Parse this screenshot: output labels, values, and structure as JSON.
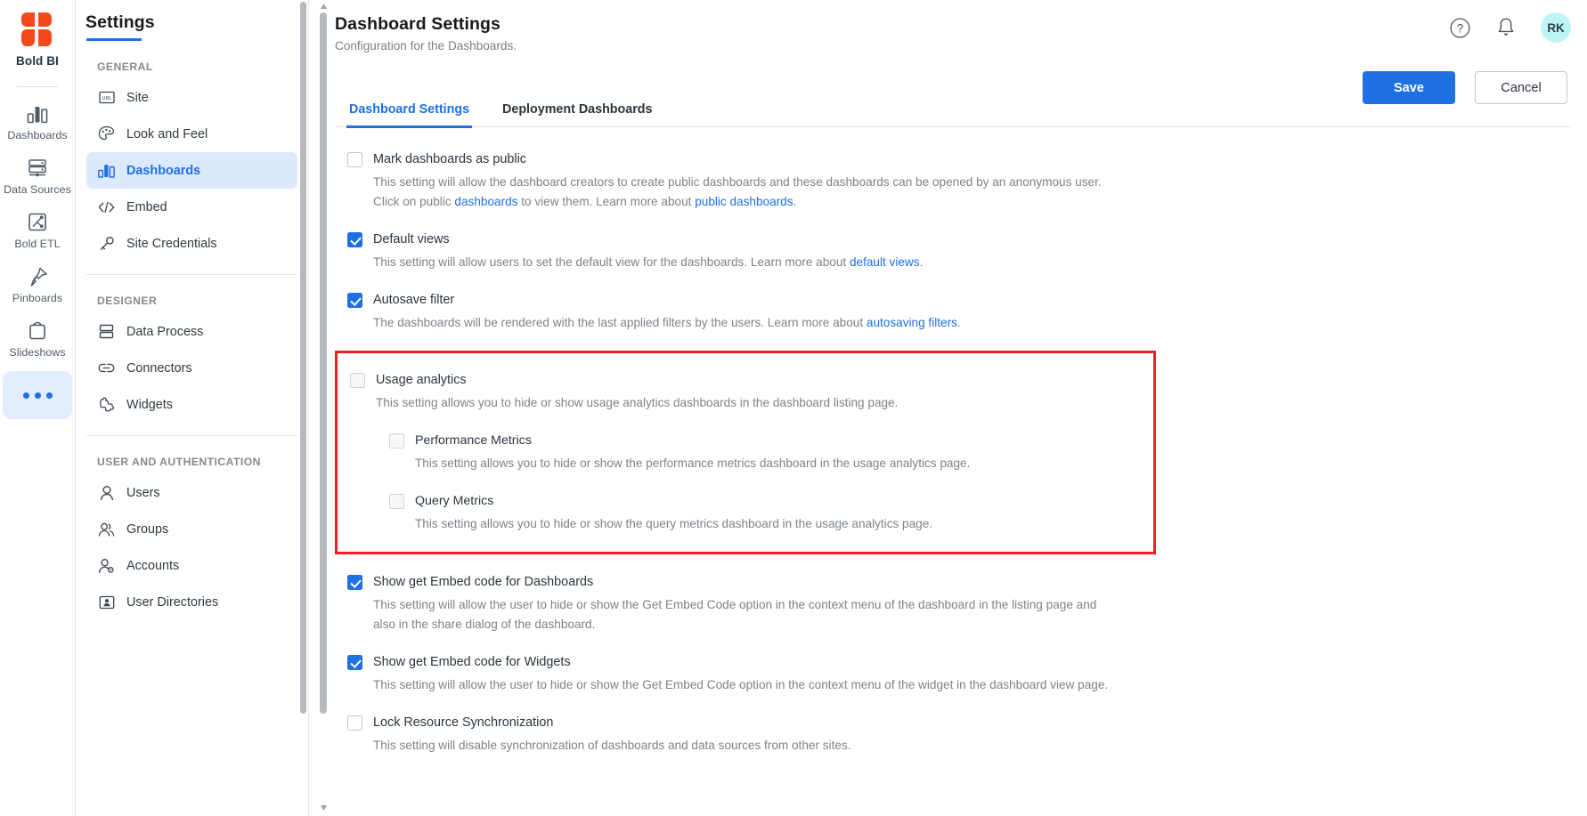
{
  "brand": {
    "name": "Bold BI",
    "logo_icon": "bold-bi-logo"
  },
  "rail": {
    "items": [
      {
        "label": "Dashboards",
        "icon": "bar-chart-icon"
      },
      {
        "label": "Data Sources",
        "icon": "database-icon"
      },
      {
        "label": "Bold ETL",
        "icon": "etl-flow-icon"
      },
      {
        "label": "Pinboards",
        "icon": "pin-icon"
      },
      {
        "label": "Slideshows",
        "icon": "tv-icon"
      }
    ],
    "more_label": "more-options",
    "more_icon": "ellipsis-icon"
  },
  "settings_nav": {
    "title": "Settings",
    "groups": [
      {
        "label": "GENERAL",
        "items": [
          {
            "label": "Site",
            "icon": "url-box-icon",
            "active": false
          },
          {
            "label": "Look and Feel",
            "icon": "palette-icon",
            "active": false
          },
          {
            "label": "Dashboards",
            "icon": "bar-chart-icon",
            "active": true
          },
          {
            "label": "Embed",
            "icon": "code-brackets-icon",
            "active": false
          },
          {
            "label": "Site Credentials",
            "icon": "key-icon",
            "active": false
          }
        ]
      },
      {
        "label": "DESIGNER",
        "items": [
          {
            "label": "Data Process",
            "icon": "stacked-rows-icon",
            "active": false
          },
          {
            "label": "Connectors",
            "icon": "link-icon",
            "active": false
          },
          {
            "label": "Widgets",
            "icon": "puzzle-icon",
            "active": false
          }
        ]
      },
      {
        "label": "USER AND AUTHENTICATION",
        "items": [
          {
            "label": "Users",
            "icon": "user-icon",
            "active": false
          },
          {
            "label": "Groups",
            "icon": "users-group-icon",
            "active": false
          },
          {
            "label": "Accounts",
            "icon": "user-gear-icon",
            "active": false
          },
          {
            "label": "User Directories",
            "icon": "id-card-icon",
            "active": false
          }
        ]
      }
    ]
  },
  "header": {
    "title": "Dashboard Settings",
    "subtitle": "Configuration for the Dashboards.",
    "help_icon": "question-circle-icon",
    "notification_icon": "bell-icon",
    "avatar_initials": "RK"
  },
  "actions": {
    "save_label": "Save",
    "cancel_label": "Cancel"
  },
  "tabs": [
    {
      "label": "Dashboard Settings",
      "active": true
    },
    {
      "label": "Deployment Dashboards",
      "active": false
    }
  ],
  "settings": {
    "mark_public": {
      "label": "Mark dashboards as public",
      "checked": false,
      "desc_part1": "This setting will allow the dashboard creators to create public dashboards and these dashboards can be opened by an anonymous user. Click on public ",
      "link1": "dashboards",
      "desc_part2": " to view them. Learn more about ",
      "link2": "public dashboards",
      "desc_part3": "."
    },
    "default_views": {
      "label": "Default views",
      "checked": true,
      "desc_part1": "This setting will allow users to set the default view for the dashboards. Learn more about ",
      "link1": "default views",
      "desc_part2": "."
    },
    "autosave_filter": {
      "label": "Autosave filter",
      "checked": true,
      "desc_part1": "The dashboards will be rendered with the last applied filters by the users. Learn more about ",
      "link1": "autosaving filters",
      "desc_part2": "."
    },
    "usage_analytics": {
      "label": "Usage analytics",
      "checked": false,
      "desc": "This setting allows you to hide or show usage analytics dashboards in the dashboard listing page.",
      "highlight_color": "#ef2024",
      "children": [
        {
          "label": "Performance Metrics",
          "checked": false,
          "desc": "This setting allows you to hide or show the performance metrics dashboard in the usage analytics page."
        },
        {
          "label": "Query Metrics",
          "checked": false,
          "desc": "This setting allows you to hide or show the query metrics dashboard in the usage analytics page."
        }
      ]
    },
    "embed_dashboards": {
      "label": "Show get Embed code for Dashboards",
      "checked": true,
      "desc": "This setting will allow the user to hide or show the Get Embed Code option in the context menu of the dashboard in the listing page and also in the share dialog of the dashboard."
    },
    "embed_widgets": {
      "label": "Show get Embed code for Widgets",
      "checked": true,
      "desc": "This setting will allow the user to hide or show the Get Embed Code option in the context menu of the widget in the dashboard view page."
    },
    "lock_resource_sync": {
      "label": "Lock Resource Synchronization",
      "checked": false,
      "desc": "This setting will disable synchronization of dashboards and data sources from other sites."
    }
  },
  "colors": {
    "accent": "#1f6fe5",
    "highlight": "#ef2024",
    "nav_active_bg": "#dce9fc",
    "avatar_bg": "#bdf5f5"
  }
}
